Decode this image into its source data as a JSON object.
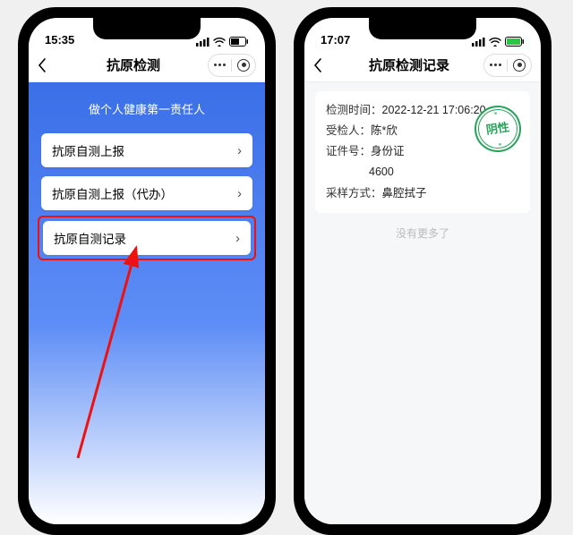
{
  "left": {
    "status_time": "15:35",
    "nav_title": "抗原检测",
    "slogan": "做个人健康第一责任人",
    "items": [
      {
        "label": "抗原自测上报"
      },
      {
        "label": "抗原自测上报（代办）"
      },
      {
        "label": "抗原自测记录"
      }
    ]
  },
  "right": {
    "status_time": "17:07",
    "nav_title": "抗原检测记录",
    "record": {
      "time_label": "检测时间：",
      "time_value": "2022-12-21 17:06:20",
      "person_label": "受检人：",
      "person_value": "陈*欣",
      "id_label": "证件号：",
      "id_type": "身份证",
      "id_value": "4600",
      "method_label": "采样方式：",
      "method_value": "鼻腔拭子",
      "result_stamp": "阴性"
    },
    "end_text": "没有更多了"
  }
}
